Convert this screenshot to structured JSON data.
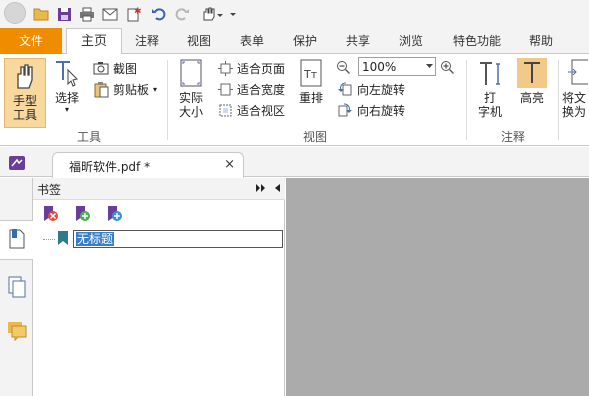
{
  "menu": {
    "tabs": [
      "文件",
      "主页",
      "注释",
      "视图",
      "表单",
      "保护",
      "共享",
      "浏览",
      "特色功能",
      "帮助"
    ],
    "active_tab": "主页"
  },
  "ribbon": {
    "hand_tool": "手型\n工具",
    "select": "选择",
    "screenshot": "截图",
    "clipboard": "剪贴板",
    "tools_group": "工具",
    "actual_size": "实际\n大小",
    "fit_page": "适合页面",
    "fit_width": "适合宽度",
    "fit_visible": "适合视区",
    "reflow": "重排",
    "zoom_value": "100%",
    "rotate_left": "向左旋转",
    "rotate_right": "向右旋转",
    "view_group": "视图",
    "typewriter": "打\n字机",
    "highlight": "高亮",
    "comment_group": "注释",
    "convert_partial": "将文\n换为"
  },
  "document": {
    "tab_title": "福昕软件.pdf *",
    "close": "×"
  },
  "bookmarks": {
    "title": "书签",
    "item_value": "无标题"
  },
  "colors": {
    "file_tab": "#f08c00",
    "selected_button": "#f8d89c",
    "canvas": "#ababab",
    "selection": "#3b7ec8"
  }
}
